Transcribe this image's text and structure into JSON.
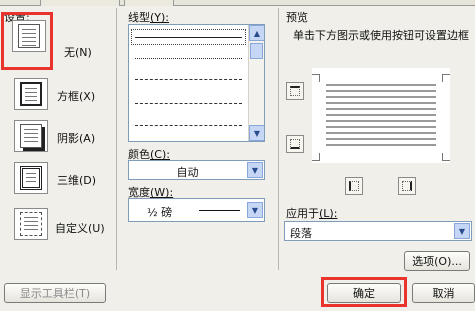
{
  "settings": {
    "section_label": "设置:",
    "items": [
      {
        "label": "无",
        "key": "(N)"
      },
      {
        "label": "方框",
        "key": "(X)"
      },
      {
        "label": "阴影",
        "key": "(A)"
      },
      {
        "label": "三维",
        "key": "(D)"
      },
      {
        "label": "自定义",
        "key": "(U)"
      }
    ],
    "selected_index": 0
  },
  "line_style": {
    "label": "线型",
    "key": "(Y):",
    "options": [
      "solid",
      "dotted",
      "dashed",
      "dash-dot",
      "dash-dot-dot"
    ]
  },
  "color": {
    "label": "颜色",
    "key": "(C):",
    "value": "自动"
  },
  "width": {
    "label": "宽度",
    "key": "(W):",
    "value": "½ 磅"
  },
  "preview": {
    "label": "预览",
    "hint": "单击下方图示或使用按钮可设置边框"
  },
  "apply_to": {
    "label": "应用于",
    "key": "(L):",
    "value": "段落"
  },
  "buttons": {
    "options": "选项(O)...",
    "show_toolbar": "显示工具栏(T)",
    "ok": "确定",
    "cancel": "取消"
  },
  "colors": {
    "highlight": "#e8342c",
    "dialog_bg": "#f0efe9",
    "scroll_accent": "#c6d6f5"
  }
}
